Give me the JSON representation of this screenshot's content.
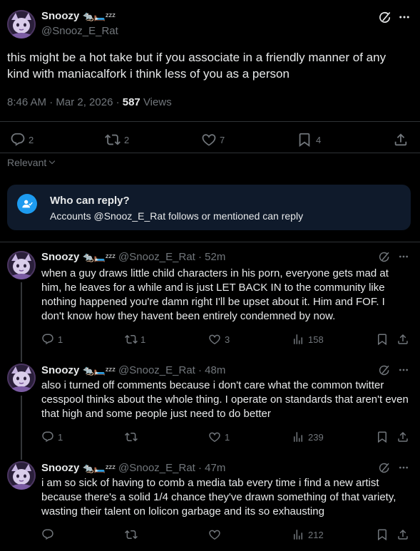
{
  "main_tweet": {
    "author_name": "Snoozy",
    "author_emoji": "🐀🛏️ᶻᶻᶻ",
    "handle": "@Snooz_E_Rat",
    "text": "this might be a hot take but if you associate in a friendly manner of any kind with maniacalfork i think less of you as a person",
    "time": "8:46 AM · Mar 2, 2026 · ",
    "views_count": "587",
    "views_label": " Views",
    "replies": "2",
    "reposts": "2",
    "likes": "7",
    "bookmarks": "4"
  },
  "sort_label": "Relevant",
  "reply_notice": {
    "title": "Who can reply?",
    "body": "Accounts @Snooz_E_Rat follows or mentioned can reply"
  },
  "replies": [
    {
      "author_name": "Snoozy",
      "author_emoji": "🐀🛏️ᶻᶻᶻ",
      "handle_time": "@Snooz_E_Rat · 52m",
      "text": "when a guy draws little child characters in his porn, everyone gets mad at him, he leaves for a while and is just LET BACK IN to the community like nothing happened you're damn right I'll be upset about it. Him and FOF. I don't know how they havent been entirely condemned by now.",
      "replies": "1",
      "reposts": "1",
      "likes": "3",
      "views": "158"
    },
    {
      "author_name": "Snoozy",
      "author_emoji": "🐀🛏️ᶻᶻᶻ",
      "handle_time": "@Snooz_E_Rat · 48m",
      "text": "also i turned off comments because i don't care what the common twitter cesspool thinks about the whole thing. I operate on standards that aren't even that high and some people just need to do better",
      "replies": "1",
      "reposts": "",
      "likes": "1",
      "views": "239"
    },
    {
      "author_name": "Snoozy",
      "author_emoji": "🐀🛏️ᶻᶻᶻ",
      "handle_time": "@Snooz_E_Rat · 47m",
      "text": "i am so sick of having to comb a media tab every time i find a new artist because there's a solid 1/4 chance they've drawn something of that variety, wasting their talent on lolicon garbage and its so exhausting",
      "replies": "",
      "reposts": "",
      "likes": "",
      "views": "212"
    }
  ],
  "colors": {
    "background": "#000000",
    "text": "#e7e9ea",
    "secondary": "#71767b",
    "accent": "#1d9bf0",
    "notice_bg": "#0f1a2b"
  }
}
